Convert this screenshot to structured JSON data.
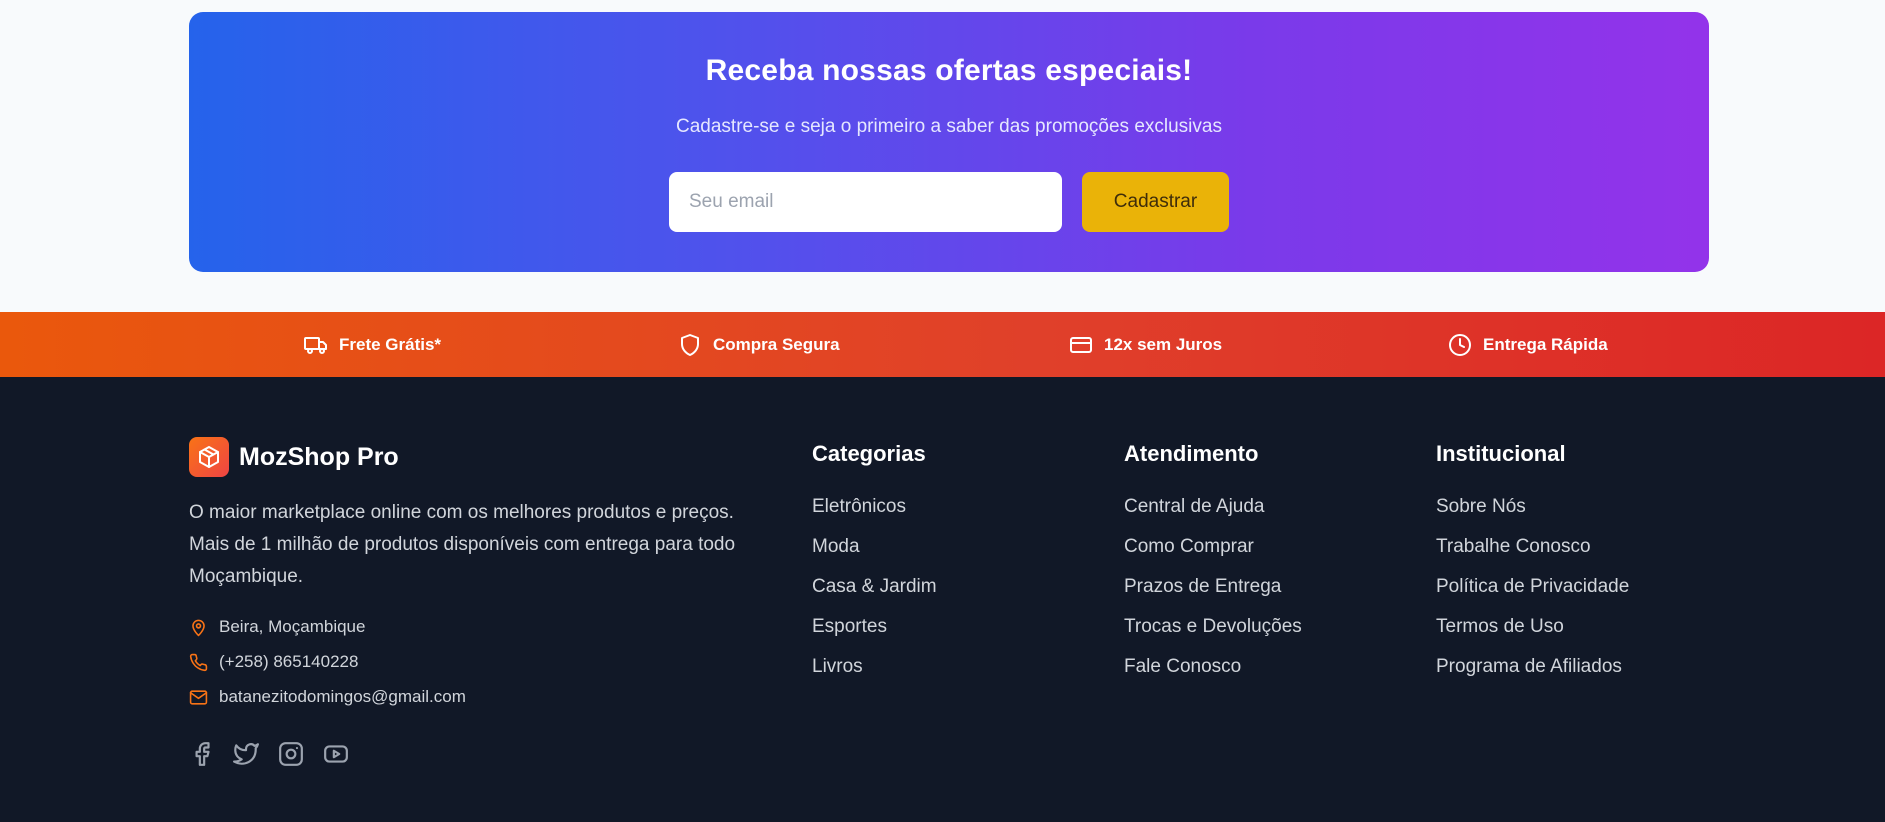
{
  "newsletter": {
    "title": "Receba nossas ofertas especiais!",
    "subtitle": "Cadastre-se e seja o primeiro a saber das promoções exclusivas",
    "email_placeholder": "Seu email",
    "button_label": "Cadastrar"
  },
  "benefits": [
    {
      "label": "Frete Grátis*",
      "icon": "truck-icon"
    },
    {
      "label": "Compra Segura",
      "icon": "shield-icon"
    },
    {
      "label": "12x sem Juros",
      "icon": "credit-card-icon"
    },
    {
      "label": "Entrega Rápida",
      "icon": "clock-icon"
    }
  ],
  "brand": {
    "name": "MozShop Pro",
    "icon": "package-icon",
    "description_lines": [
      "O maior marketplace online com os melhores produtos e preços.",
      "Mais de 1 milhão de produtos disponíveis com entrega para todo",
      "Moçambique."
    ],
    "location": "Beira, Moçambique",
    "phone": "(+258) 865140228",
    "email": "batanezitodomingos@gmail.com"
  },
  "socials": [
    "facebook-icon",
    "twitter-icon",
    "instagram-icon",
    "youtube-icon"
  ],
  "columns": [
    {
      "title": "Categorias",
      "links": [
        "Eletrônicos",
        "Moda",
        "Casa & Jardim",
        "Esportes",
        "Livros"
      ]
    },
    {
      "title": "Atendimento",
      "links": [
        "Central de Ajuda",
        "Como Comprar",
        "Prazos de Entrega",
        "Trocas e Devoluções",
        "Fale Conosco"
      ]
    },
    {
      "title": "Institucional",
      "links": [
        "Sobre Nós",
        "Trabalhe Conosco",
        "Política de Privacidade",
        "Termos de Uso",
        "Programa de Afiliados"
      ]
    }
  ],
  "colors": {
    "gradient_start": "#2563eb",
    "gradient_end": "#9333ea",
    "button_yellow": "#eab308",
    "benefits_start": "#ea580c",
    "benefits_end": "#dc2626",
    "footer_bg": "#111827",
    "accent_orange": "#f97316"
  }
}
